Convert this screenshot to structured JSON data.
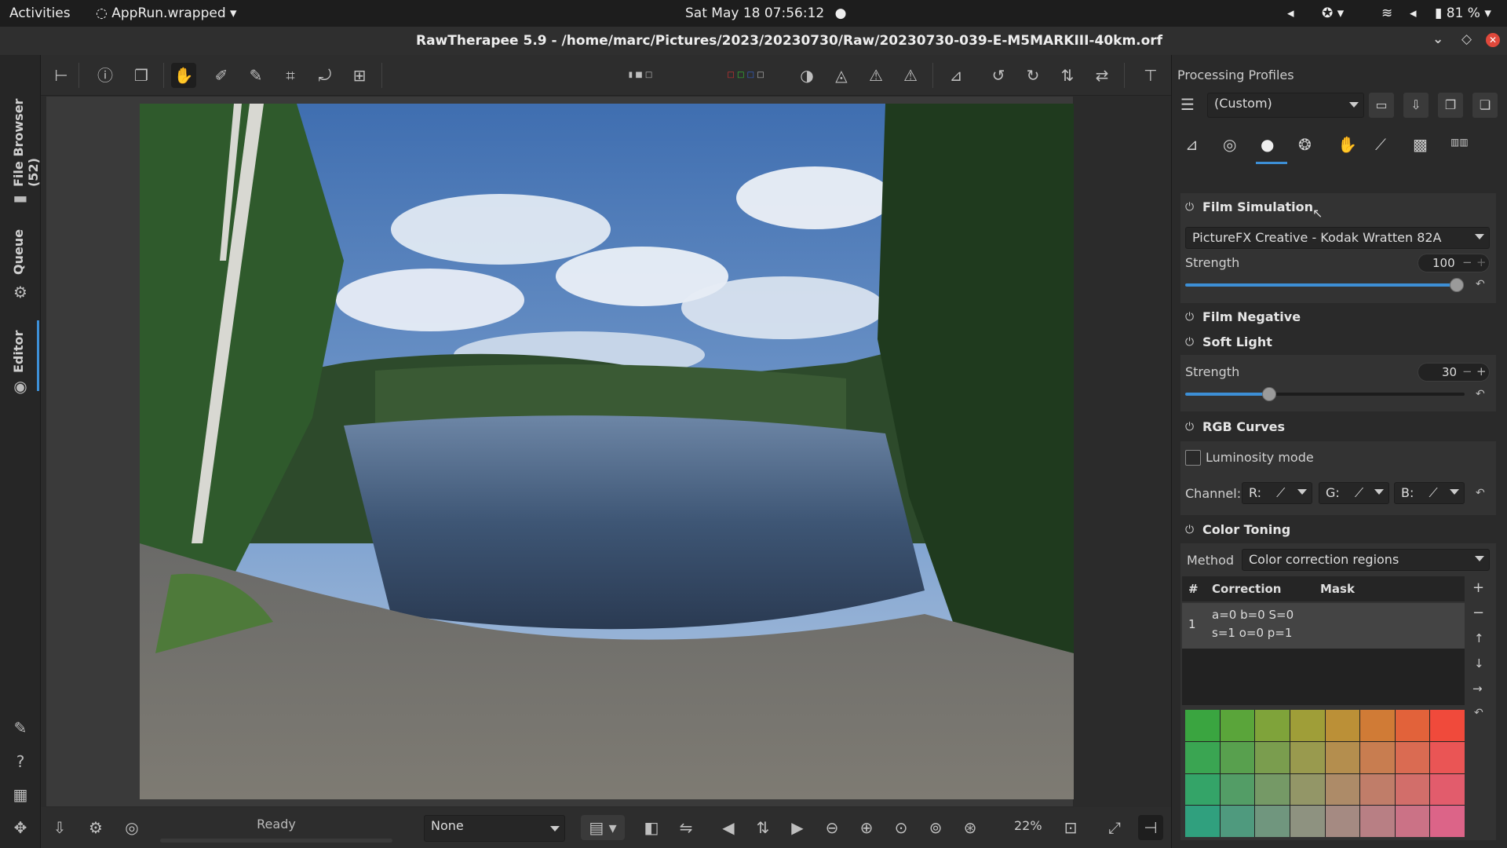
{
  "system_bar": {
    "activities": "Activities",
    "app_name": "AppRun.wrapped",
    "clock": "Sat May 18  07:56:12",
    "battery": "81 %"
  },
  "window": {
    "title": "RawTherapee 5.9 - /home/marc/Pictures/2023/20230730/Raw/20230730-039-E-M5MARKIII-40km.orf"
  },
  "left_tabs": {
    "file_browser": "File Browser (52)",
    "queue": "Queue",
    "editor": "Editor"
  },
  "right_panel": {
    "header": "Processing Profiles",
    "profile_value": "(Custom)",
    "film_simulation": {
      "title": "Film Simulation",
      "preset": "PictureFX Creative - Kodak Wratten 82A",
      "strength_label": "Strength",
      "strength_value": "100",
      "strength_fraction": 1.0
    },
    "film_negative": {
      "title": "Film Negative"
    },
    "soft_light": {
      "title": "Soft Light",
      "strength_label": "Strength",
      "strength_value": "30",
      "strength_fraction": 0.3
    },
    "rgb_curves": {
      "title": "RGB Curves",
      "luminosity_label": "Luminosity mode",
      "channel_label": "Channel:",
      "r_label": "R:",
      "g_label": "G:",
      "b_label": "B:"
    },
    "color_toning": {
      "title": "Color Toning",
      "method_label": "Method",
      "method_value": "Color correction regions",
      "col_hash": "#",
      "col_correction": "Correction",
      "col_mask": "Mask",
      "row_index": "1",
      "row_line1": "a=0 b=0 S=0",
      "row_line2": "s=1 o=0 p=1"
    }
  },
  "bottom_bar": {
    "status": "Ready",
    "preset_value": "None",
    "zoom": "22%"
  },
  "colors": {
    "accent": "#3d8fd6",
    "close_button": "#e0483b"
  }
}
